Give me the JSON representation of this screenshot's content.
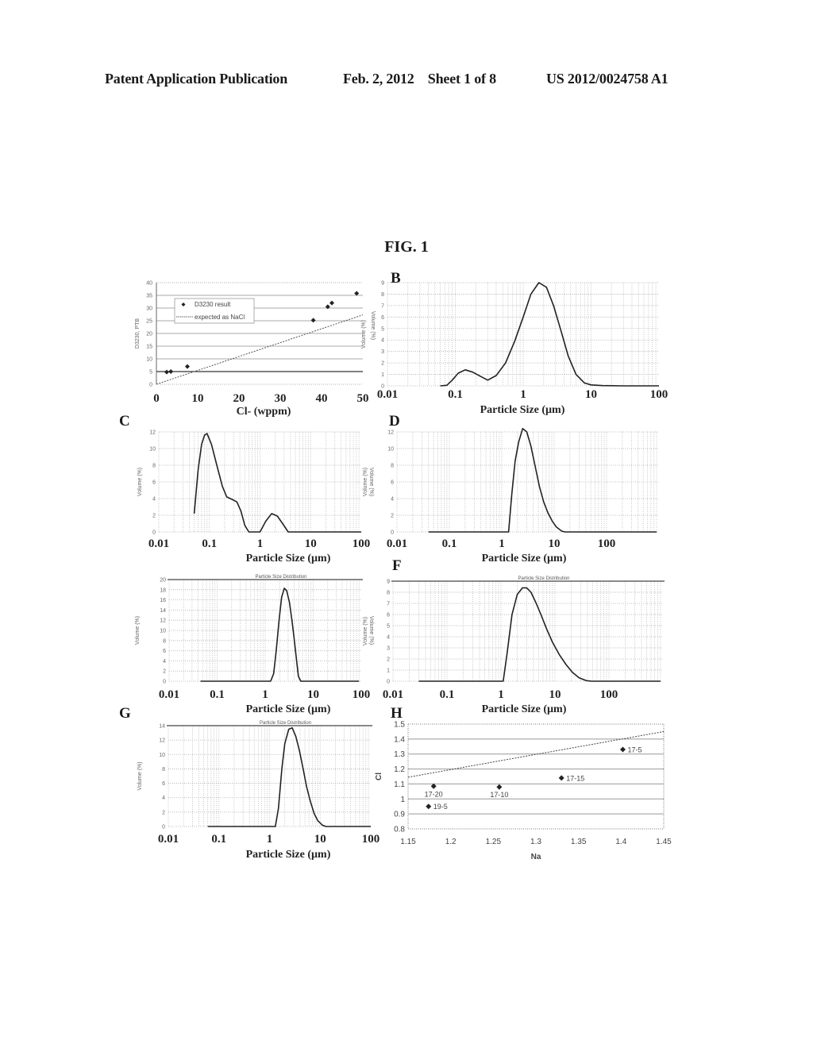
{
  "header": {
    "left": "Patent Application Publication",
    "middle": "Feb. 2, 2012    Sheet 1 of 8",
    "right": "US 2012/0024758 A1"
  },
  "figure_title": "FIG. 1",
  "chart_data": [
    {
      "id": "A",
      "panel_letter": "",
      "type": "scatter",
      "title": "",
      "xlabel": "Cl- (wppm)",
      "ylabel": "D3230, PTB",
      "right_ylabel": "Volume (%)",
      "xlim": [
        0,
        50
      ],
      "ylim": [
        0,
        40
      ],
      "xticks": [
        "0",
        "10",
        "20",
        "30",
        "40",
        "50"
      ],
      "yticks": [
        "0",
        "5",
        "10",
        "15",
        "20",
        "25",
        "30",
        "35",
        "40"
      ],
      "grid": true,
      "legend": {
        "position": "top-left",
        "entries": [
          "D3230 result",
          "expected as NaCl"
        ]
      },
      "series": [
        {
          "name": "D3230 result",
          "kind": "points",
          "x": [
            2.5,
            3.5,
            7.5,
            38,
            41.5,
            42.5,
            48.5
          ],
          "y": [
            4.8,
            5.0,
            7.0,
            25.2,
            30.5,
            32.0,
            35.8
          ]
        },
        {
          "name": "expected as NaCl",
          "kind": "dotted-line",
          "x": [
            0,
            50
          ],
          "y": [
            0,
            27.3
          ]
        }
      ]
    },
    {
      "id": "B",
      "panel_letter": "B",
      "type": "line",
      "title": "",
      "xlabel": "Particle Size (µm)",
      "ylabel": "Volume (%)",
      "xscale": "log",
      "xlim": [
        0.01,
        100
      ],
      "ylim": [
        0,
        9
      ],
      "xticks": [
        "0.01",
        "0.1",
        "1",
        "10",
        "100"
      ],
      "yticks": [
        "0",
        "1",
        "2",
        "3",
        "4",
        "5",
        "6",
        "7",
        "8",
        "9"
      ],
      "grid": true,
      "series": [
        {
          "name": "volume",
          "x": [
            0.06,
            0.075,
            0.09,
            0.11,
            0.14,
            0.18,
            0.24,
            0.3,
            0.4,
            0.55,
            0.75,
            1.0,
            1.3,
            1.7,
            2.2,
            2.8,
            3.6,
            4.6,
            6,
            8,
            10,
            15,
            30,
            100
          ],
          "y": [
            0,
            0.05,
            0.5,
            1.1,
            1.4,
            1.2,
            0.8,
            0.5,
            0.9,
            2.0,
            3.9,
            6.0,
            8.0,
            9.0,
            8.6,
            7.0,
            4.8,
            2.6,
            1.0,
            0.25,
            0.08,
            0.02,
            0,
            0
          ]
        }
      ]
    },
    {
      "id": "C",
      "panel_letter": "C",
      "type": "line",
      "title": "",
      "xlabel": "Particle Size (µm)",
      "ylabel": "Volume (%)",
      "right_ylabel": "Volume (%)",
      "xscale": "log",
      "xlim": [
        0.01,
        100
      ],
      "ylim": [
        0,
        12
      ],
      "xticks": [
        "0.01",
        "0.1",
        "1",
        "10",
        "100"
      ],
      "yticks": [
        "0",
        "2",
        "4",
        "6",
        "8",
        "10",
        "12"
      ],
      "grid": true,
      "series": [
        {
          "name": "volume",
          "x": [
            0.05,
            0.06,
            0.07,
            0.08,
            0.09,
            0.11,
            0.14,
            0.18,
            0.22,
            0.28,
            0.35,
            0.42,
            0.5,
            0.6,
            1.0,
            1.3,
            1.7,
            2.2,
            2.8,
            3.6,
            5,
            100
          ],
          "y": [
            2.2,
            7.5,
            10.5,
            11.6,
            11.8,
            10.5,
            8.0,
            5.5,
            4.2,
            3.9,
            3.6,
            2.5,
            0.8,
            0,
            0,
            1.3,
            2.2,
            1.9,
            1.0,
            0,
            0,
            0
          ]
        }
      ]
    },
    {
      "id": "D",
      "panel_letter": "D",
      "type": "line",
      "title": "",
      "xlabel": "Particle Size (µm)",
      "ylabel": "Volume (%)",
      "xscale": "log",
      "xlim": [
        0.01,
        1000
      ],
      "ylim": [
        0,
        12
      ],
      "xticks": [
        "0.01",
        "0.1",
        "1",
        "10",
        "100"
      ],
      "yticks": [
        "0",
        "2",
        "4",
        "6",
        "8",
        "10",
        "12"
      ],
      "grid": true,
      "series": [
        {
          "name": "volume",
          "x": [
            0.04,
            1.0,
            1.35,
            1.55,
            1.8,
            2.1,
            2.5,
            3.0,
            3.6,
            4.3,
            5.2,
            6.3,
            7.6,
            9.2,
            11,
            14,
            16,
            30,
            900
          ],
          "y": [
            0,
            0,
            0,
            4.5,
            8.5,
            10.8,
            12.4,
            12.0,
            10.3,
            8.0,
            5.5,
            3.6,
            2.3,
            1.3,
            0.6,
            0.1,
            0,
            0,
            0
          ]
        }
      ]
    },
    {
      "id": "E",
      "panel_letter": "",
      "type": "line",
      "title": "Particle Size Distribution",
      "xlabel": "Particle Size (µm)",
      "ylabel": "Volume (%)",
      "right_ylabel": "Volume (%)",
      "xscale": "log",
      "xlim": [
        0.01,
        100
      ],
      "ylim": [
        0,
        20
      ],
      "xticks": [
        "0.01",
        "0.1",
        "1",
        "10",
        "100"
      ],
      "yticks": [
        "0",
        "2",
        "4",
        "6",
        "8",
        "10",
        "12",
        "14",
        "16",
        "18",
        "20"
      ],
      "grid": true,
      "series": [
        {
          "name": "volume",
          "x": [
            0.045,
            1.3,
            1.5,
            1.7,
            1.95,
            2.2,
            2.5,
            2.8,
            3.2,
            3.6,
            4.0,
            4.4,
            4.9,
            5.5,
            90
          ],
          "y": [
            0,
            0,
            1.5,
            6.0,
            12.0,
            16.5,
            18.3,
            17.8,
            15.5,
            12.0,
            8.5,
            5.0,
            1.0,
            0,
            0
          ]
        }
      ]
    },
    {
      "id": "F",
      "panel_letter": "F",
      "type": "line",
      "title": "Particle Size Distribution",
      "xlabel": "Particle Size (µm)",
      "ylabel": "Volume (%)",
      "xscale": "log",
      "xlim": [
        0.01,
        1000
      ],
      "ylim": [
        0,
        9
      ],
      "xticks": [
        "0.01",
        "0.1",
        "1",
        "10",
        "100"
      ],
      "yticks": [
        "0",
        "1",
        "2",
        "3",
        "4",
        "5",
        "6",
        "7",
        "8",
        "9"
      ],
      "grid": true,
      "series": [
        {
          "name": "volume",
          "x": [
            0.03,
            1.1,
            1.3,
            1.6,
            2.0,
            2.5,
            3.0,
            3.6,
            4.5,
            5.5,
            7,
            9,
            12,
            16,
            21,
            28,
            38,
            48,
            900
          ],
          "y": [
            0,
            0,
            2.5,
            6.0,
            7.8,
            8.4,
            8.4,
            8.0,
            7.0,
            6.0,
            4.7,
            3.5,
            2.4,
            1.5,
            0.8,
            0.3,
            0.05,
            0,
            0
          ]
        }
      ]
    },
    {
      "id": "G",
      "panel_letter": "G",
      "type": "line",
      "title": "Particle Size Distribution",
      "xlabel": "Particle Size (µm)",
      "ylabel": "Volume (%)",
      "xscale": "log",
      "xlim": [
        0.01,
        100
      ],
      "ylim": [
        0,
        14
      ],
      "xticks": [
        "0.01",
        "0.1",
        "1",
        "10",
        "100"
      ],
      "yticks": [
        "0",
        "2",
        "4",
        "6",
        "8",
        "10",
        "12",
        "14"
      ],
      "grid": true,
      "series": [
        {
          "name": "volume",
          "x": [
            0.06,
            1.3,
            1.5,
            1.75,
            2.0,
            2.4,
            2.8,
            3.3,
            3.9,
            4.6,
            5.4,
            6.4,
            7.6,
            9.0,
            11,
            13,
            100
          ],
          "y": [
            0,
            0,
            2.5,
            8.0,
            11.5,
            13.5,
            13.7,
            12.5,
            10.5,
            8.0,
            5.5,
            3.5,
            1.8,
            0.8,
            0.2,
            0,
            0
          ]
        }
      ]
    },
    {
      "id": "H",
      "panel_letter": "H",
      "type": "scatter",
      "title": "",
      "xlabel": "Na",
      "ylabel": "Cl",
      "xlim": [
        1.15,
        1.45
      ],
      "ylim": [
        0.8,
        1.5
      ],
      "xticks": [
        "1.15",
        "1.2",
        "1.25",
        "1.3",
        "1.35",
        "1.4",
        "1.45"
      ],
      "yticks": [
        "0.8",
        "0.9",
        "1",
        "1.1",
        "1.2",
        "1.3",
        "1.4",
        "1.5"
      ],
      "grid": true,
      "series": [
        {
          "name": "samples",
          "kind": "points",
          "points": [
            {
              "label": "17-5",
              "x": 1.402,
              "y": 1.33
            },
            {
              "label": "17-15",
              "x": 1.33,
              "y": 1.14
            },
            {
              "label": "17-10",
              "x": 1.257,
              "y": 1.08
            },
            {
              "label": "17-20",
              "x": 1.18,
              "y": 1.085
            },
            {
              "label": "19-5",
              "x": 1.174,
              "y": 0.95
            }
          ]
        },
        {
          "name": "expected",
          "kind": "dotted-line",
          "x": [
            1.15,
            1.45
          ],
          "y": [
            1.145,
            1.45
          ]
        }
      ]
    }
  ]
}
